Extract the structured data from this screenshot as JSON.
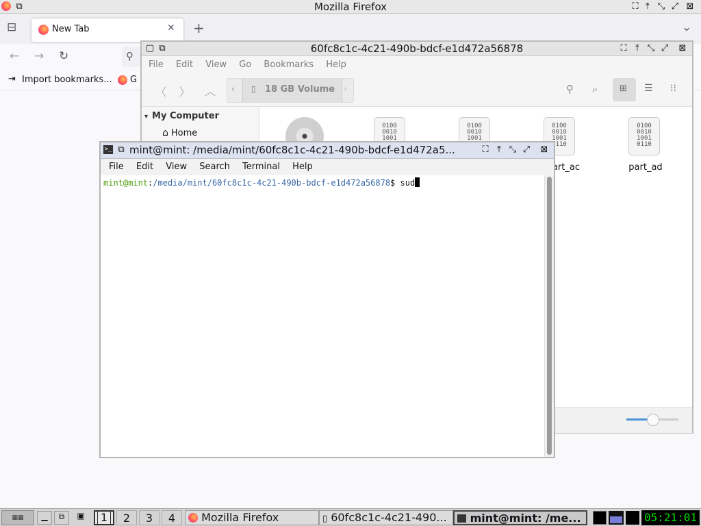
{
  "firefox": {
    "window_title": "Mozilla Firefox",
    "tab_label": "New Tab",
    "bookmarks": [
      {
        "label": "Import bookmarks..."
      },
      {
        "label": "G"
      }
    ]
  },
  "nemo": {
    "window_title": "60fc8c1c-4c21-490b-bdcf-e1d472a56878",
    "menu": [
      "File",
      "Edit",
      "View",
      "Go",
      "Bookmarks",
      "Help"
    ],
    "location": "18 GB Volume",
    "sidebar": {
      "section": "My Computer",
      "items": [
        {
          "label": "Home"
        }
      ]
    },
    "files": [
      {
        "label": "",
        "icon": "disc-icon"
      },
      {
        "label": "",
        "icon": "binary-file-icon"
      },
      {
        "label": "",
        "icon": "binary-file-icon"
      },
      {
        "label": "part_ac",
        "icon": "binary-file-icon"
      },
      {
        "label": "part_ad",
        "icon": "binary-file-icon"
      }
    ],
    "binary_glyph": [
      "0100",
      "0010",
      "1001",
      "0110"
    ]
  },
  "terminal": {
    "window_title": "mint@mint: /media/mint/60fc8c1c-4c21-490b-bdcf-e1d472a5...",
    "menu": [
      "File",
      "Edit",
      "View",
      "Search",
      "Terminal",
      "Help"
    ],
    "prompt_user": "mint@mint",
    "prompt_sep": ":",
    "prompt_path": "/media/mint/60fc8c1c-4c21-490b-bdcf-e1d472a56878",
    "prompt_symbol": "$",
    "command": "sud"
  },
  "taskbar": {
    "workspaces": [
      "1",
      "2",
      "3",
      "4"
    ],
    "windows": [
      {
        "label": "Mozilla Firefox",
        "icon": "firefox-icon"
      },
      {
        "label": "60fc8c1c-4c21-490...",
        "icon": "folder-icon"
      },
      {
        "label": "mint@mint: /me...",
        "icon": "terminal-icon"
      }
    ],
    "clock": "05:21:01"
  },
  "colors": {
    "prompt_user": "#4e9a06",
    "prompt_path": "#3465a4",
    "clock_bg": "#000000",
    "clock_fg": "#00ff00"
  }
}
